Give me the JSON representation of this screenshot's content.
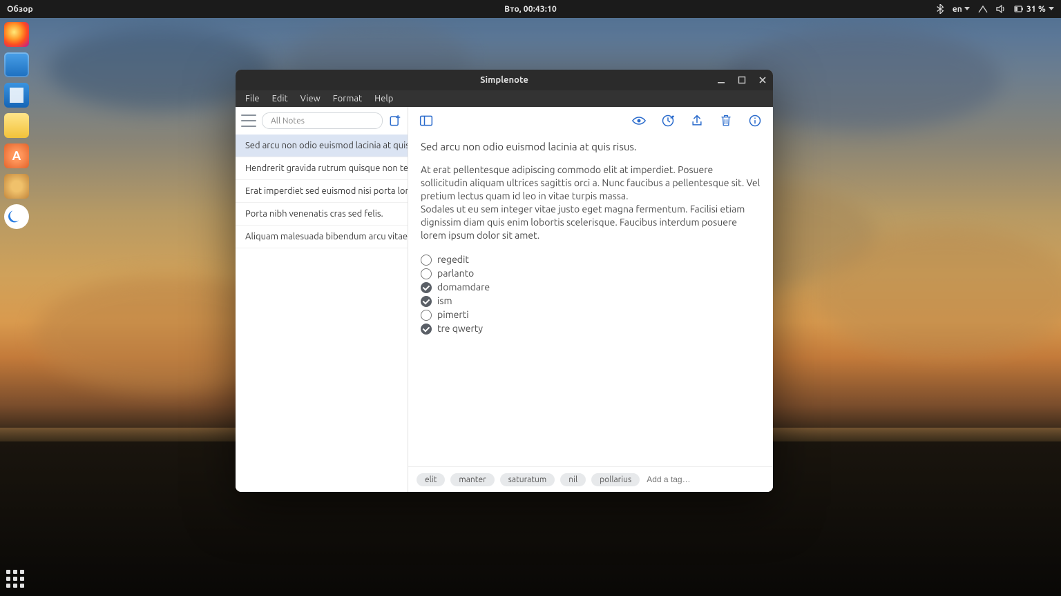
{
  "topbar": {
    "activities": "Обзор",
    "clock": "Вто, 00:43:10",
    "lang": "en",
    "battery": "31 %"
  },
  "window": {
    "title": "Simplenote",
    "menus": [
      "File",
      "Edit",
      "View",
      "Format",
      "Help"
    ]
  },
  "sidebar": {
    "search_placeholder": "All Notes",
    "notes": [
      "Sed arcu non odio euismod lacinia at quis risus.",
      "Hendrerit gravida rutrum quisque non tellus orci ac auctor augue mauris augue neque gravida.",
      "Erat imperdiet sed euismod nisi porta lorem mollis aliquam ut porttitor leo a diam sollicitudin tempor.",
      "Porta nibh venenatis cras sed felis.",
      "Aliquam malesuada bibendum arcu vitae elementum curabitur vitae nunc sed velit dignissim."
    ],
    "selected_index": 0
  },
  "editor": {
    "title": "Sed arcu non odio euismod lacinia at quis risus.",
    "body": "At erat pellentesque adipiscing commodo elit at imperdiet. Posuere sollicitudin aliquam ultrices sagittis orci a. Nunc faucibus a pellentesque sit. Vel pretium lectus quam id leo in vitae turpis massa.\nSodales ut eu sem integer vitae justo eget magna fermentum. Facilisi etiam dignissim diam quis enim lobortis scelerisque. Faucibus interdum posuere lorem ipsum dolor sit amet.",
    "checklist": [
      {
        "label": "regedit",
        "checked": false
      },
      {
        "label": "parlanto",
        "checked": false
      },
      {
        "label": "domamdare",
        "checked": true
      },
      {
        "label": "ism",
        "checked": true
      },
      {
        "label": "pimerti",
        "checked": false
      },
      {
        "label": "tre qwerty",
        "checked": true
      }
    ],
    "tags": [
      "elit",
      "manter",
      "saturatum",
      "nil",
      "pollarius"
    ],
    "tag_placeholder": "Add a tag…"
  }
}
